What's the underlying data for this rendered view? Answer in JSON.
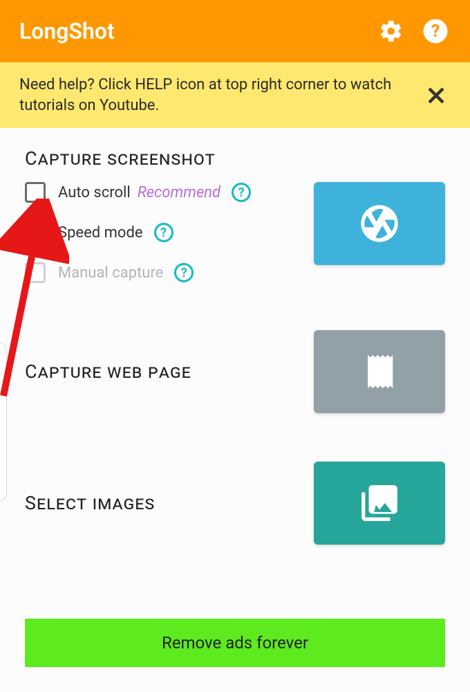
{
  "header": {
    "title": "LongShot"
  },
  "banner": {
    "text": "Need help? Click HELP icon at top right corner to watch tutorials on Youtube."
  },
  "sections": {
    "capture_screenshot": {
      "title": "Capture screenshot",
      "options": {
        "auto_scroll": {
          "label": "Auto scroll",
          "recommend": "Recommend",
          "checked": false
        },
        "speed_mode": {
          "label": "Speed mode",
          "checked": true
        },
        "manual_capture": {
          "label": "Manual capture",
          "checked": false,
          "disabled": true
        }
      }
    },
    "capture_web_page": {
      "title": "Capture web page"
    },
    "select_images": {
      "title": "Select images"
    }
  },
  "remove_ads": {
    "label": "Remove ads forever"
  },
  "icons": {
    "help_symbol": "?"
  }
}
